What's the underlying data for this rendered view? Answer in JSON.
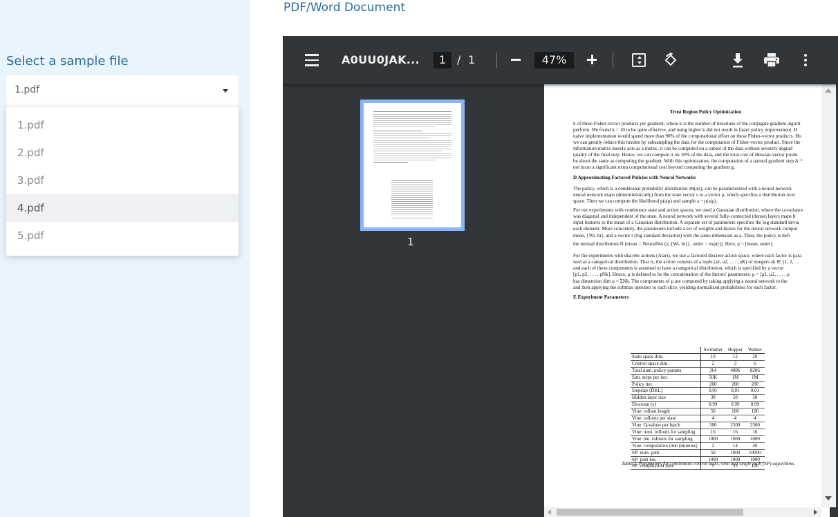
{
  "sidebar": {
    "label": "Select a sample file",
    "selected": "1.pdf",
    "options": [
      "1.pdf",
      "2.pdf",
      "3.pdf",
      "4.pdf",
      "5.pdf"
    ],
    "hovered_option": "4.pdf"
  },
  "main": {
    "title": "PDF/Word Document"
  },
  "viewer": {
    "doc_name": "A0UU0JAK...",
    "page_current": "1",
    "page_separator": "/",
    "page_total": "1",
    "zoom": "47%",
    "thumbnail_label": "1",
    "icons": [
      "menu-icon",
      "zoom-out-icon",
      "zoom-in-icon",
      "fit-page-icon",
      "rotate-icon",
      "download-icon",
      "print-icon",
      "more-icon"
    ]
  },
  "document": {
    "header": "Trust Region Policy Optimization",
    "intro_lines": [
      "k of these Fisher-vector products per gradient, where k is the number of iterations of the conjugate gradient algorit",
      "perform. We found k = 10 to be quite effective, and using higher k did not result in faster policy improvement. H",
      "naive implementation would spend more than 90% of the computational effort on these Fisher-vector products. Ho",
      "we can greatly reduce this burden by subsampling the data for the computation of Fisher-vector product. Since the",
      "information matrix merely acts as a metric, it can be computed on a subset of the data without severely degrad",
      "quality of the final step. Hence, we can compute it on 10% of the data, and the total cost of Hessian-vector produ",
      "be about the same as computing the gradient. With this optimization, the computation of a natural gradient step A⁻¹",
      "not incur a significant extra computational cost beyond computing the gradient g."
    ],
    "section_d_title": "D   Approximating Factored Policies with Neural Networks",
    "d_para1": [
      "The policy, which is a conditional probability distribution πθ(a|s), can be parameterized with a neural network",
      "neural network maps (deterministically) from the state vector s to a vector μ, which specifies a distribution over",
      "space. Then we can compute the likelihood p(a|μ) and sample a ~ p(a|μ)."
    ],
    "d_para2": [
      "For our experiments with continuous state and action spaces, we used a Gaussian distribution, where the covariance",
      "was diagonal and independent of the state. A neural network with several fully-connected (dense) layers maps fr",
      "input features to the mean of a Gaussian distribution. A separate set of parameters specifies the log standard devia",
      "each element. More concretely, the parameters include a set of weights and biases for the neural network comput",
      "mean, {Wi, bi}, and a vector r (log standard deviation) with the same dimension as a. Then, the policy is defi",
      "the normal distribution N (mean = NeuralNet (s; {Wi, bi}) , stdev = exp(r)). Here, μ = [mean, stdev]."
    ],
    "d_para3": [
      "For the experiments with discrete actions (Atari), we use a factored discrete action space, where each factor is para",
      "ized as a categorical distribution. That is, the action consists of a tuple (a1, a2, . . . , aK) of integers ak ∈ {1, 2, . .",
      "and each of these components is assumed to have a categorical distribution, which is specified by a vector",
      "[p1, p2, . . . , pNk]. Hence, μ is defined to be the concatenation of the factors' parameters: μ = [μ1, μ2, . . . , μ",
      "has dimension dim μ = ΣNk. The components of μ are computed by taking applying a neural network to the",
      "and then applying the softmax operator to each slice, yielding normalized probabilities for each factor."
    ],
    "section_e_title": "E   Experiment Parameters",
    "table": {
      "columns": [
        "",
        "Swimmer",
        "Hopper",
        "Walker"
      ],
      "rows": [
        [
          "State space dim.",
          "10",
          "12",
          "20"
        ],
        [
          "Control space dim.",
          "2",
          "3",
          "6"
        ],
        [
          "Total num. policy params",
          "364",
          "4806",
          "8206"
        ],
        [
          "Sim. steps per iter.",
          "50K",
          "1M",
          "1M"
        ],
        [
          "Policy iter.",
          "200",
          "200",
          "200"
        ],
        [
          "Stepsize (D̄KL)",
          "0.01",
          "0.01",
          "0.01"
        ],
        [
          "Hidden layer size",
          "30",
          "50",
          "50"
        ],
        [
          "Discount (γ)",
          "0.99",
          "0.99",
          "0.99"
        ],
        [
          "Vine: rollout length",
          "50",
          "100",
          "100"
        ],
        [
          "Vine: rollouts per state",
          "4",
          "4",
          "4"
        ],
        [
          "Vine: Q-values per batch",
          "500",
          "2500",
          "2500"
        ],
        [
          "Vine: num. rollouts for sampling",
          "16",
          "16",
          "16"
        ],
        [
          "Vine: len. rollouts for sampling",
          "1000",
          "1000",
          "1000"
        ],
        [
          "Vine: computation time (minutes)",
          "2",
          "14",
          "40"
        ],
        [
          "SP: num. path",
          "50",
          "1000",
          "10000"
        ],
        [
          "SP: path len.",
          "1000",
          "1000",
          "1000"
        ],
        [
          "SP: computation time",
          "5",
          "35",
          "100"
        ]
      ]
    },
    "caption": "Table 2. Parameters for continuous control tasks, vine and single path (SP) algorithms."
  }
}
